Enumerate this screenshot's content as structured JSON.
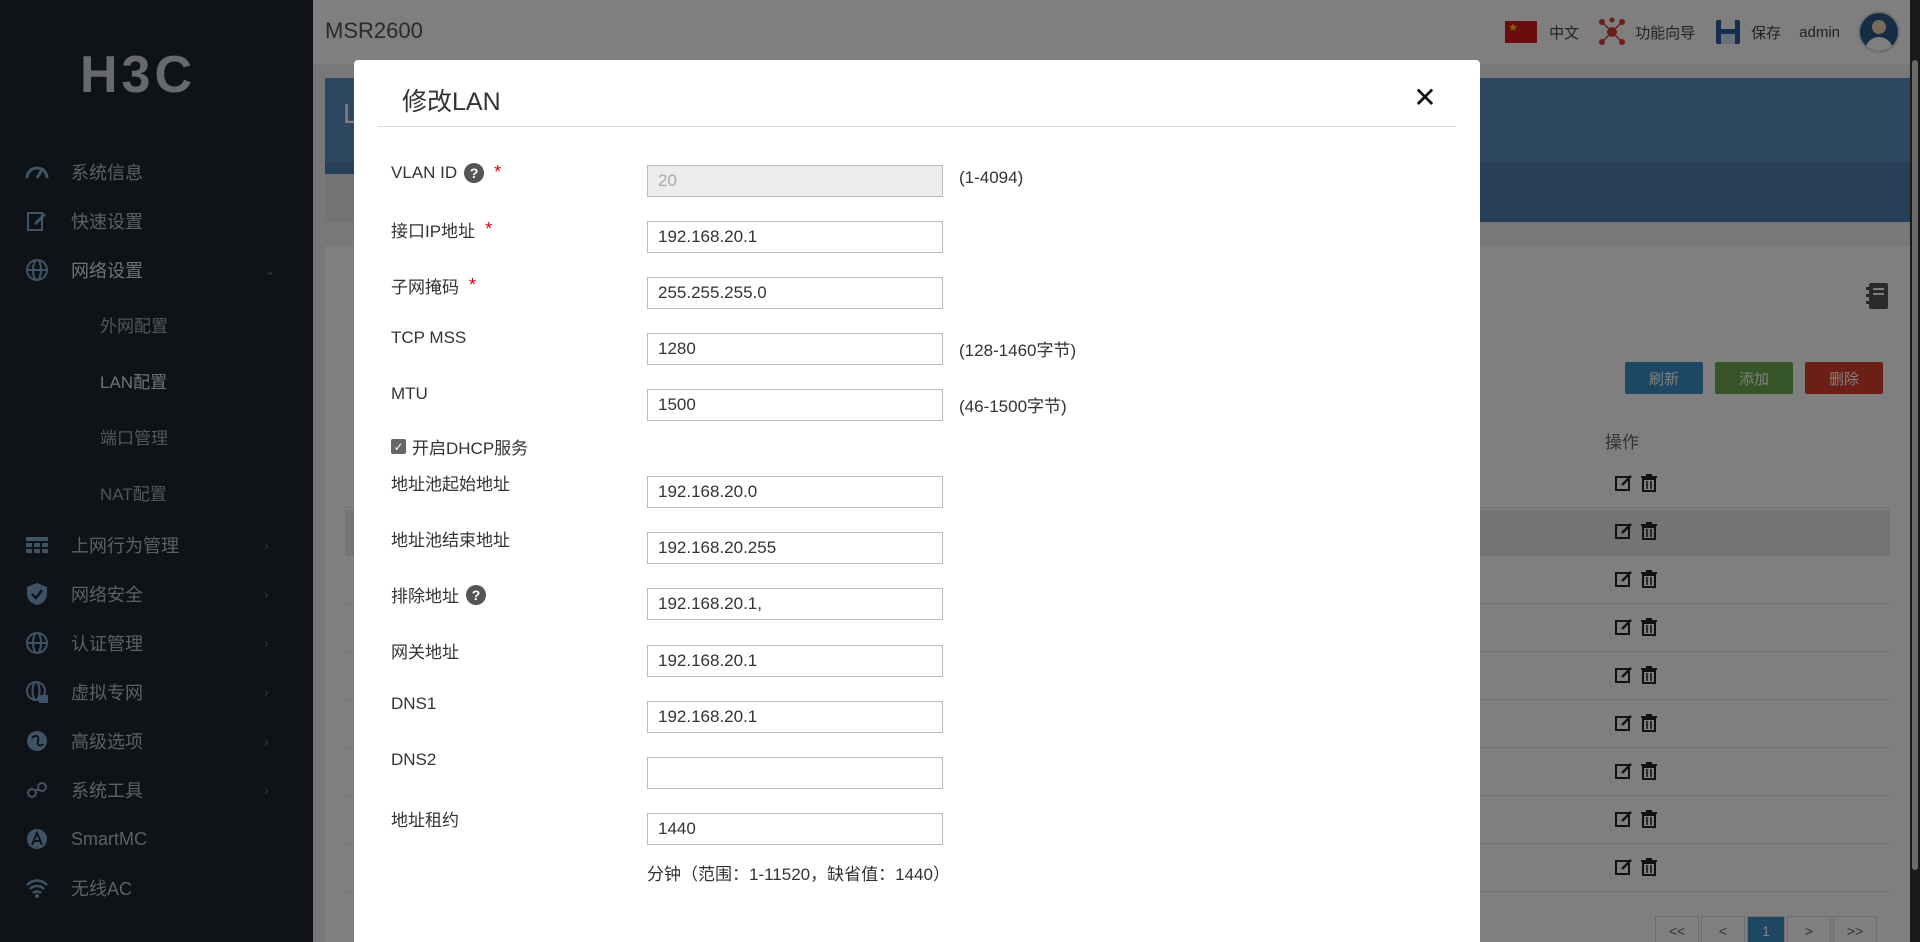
{
  "sidebar": {
    "logo": "H3C",
    "items": [
      {
        "label": "系统信息",
        "icon": "speedometer-icon"
      },
      {
        "label": "快速设置",
        "icon": "edit-icon"
      },
      {
        "label": "网络设置",
        "icon": "globe-icon",
        "expanded": true
      },
      {
        "label": "上网行为管理",
        "icon": "table-icon"
      },
      {
        "label": "网络安全",
        "icon": "shield-icon"
      },
      {
        "label": "认证管理",
        "icon": "globe-icon"
      },
      {
        "label": "虚拟专网",
        "icon": "globe-lock-icon"
      },
      {
        "label": "高级选项",
        "icon": "circle-icon"
      },
      {
        "label": "系统工具",
        "icon": "link-icon"
      },
      {
        "label": "SmartMC",
        "icon": "a-circle-icon"
      },
      {
        "label": "无线AC",
        "icon": "wifi-icon"
      }
    ],
    "subitems": [
      "外网配置",
      "LAN配置",
      "端口管理",
      "NAT配置"
    ]
  },
  "topbar": {
    "product": "MSR2600",
    "language": "中文",
    "wizard": "功能向导",
    "save": "保存",
    "user": "admin"
  },
  "background": {
    "header_initial": "L",
    "buttons": {
      "refresh": "刷新",
      "add": "添加",
      "delete": "删除"
    },
    "op_column": "操作",
    "pager": {
      "first": "<<",
      "prev": "<",
      "current": "1",
      "next": ">",
      "last": ">>"
    }
  },
  "modal": {
    "title": "修改LAN",
    "fields": {
      "vlan_id": {
        "label": "VLAN ID",
        "value": "20",
        "hint": "(1-4094)"
      },
      "ip": {
        "label": "接口IP地址",
        "value": "192.168.20.1"
      },
      "mask": {
        "label": "子网掩码",
        "value": "255.255.255.0"
      },
      "tcp_mss": {
        "label": "TCP MSS",
        "value": "1280",
        "hint": "(128-1460字节)"
      },
      "mtu": {
        "label": "MTU",
        "value": "1500",
        "hint": "(46-1500字节)"
      },
      "dhcp": {
        "label": "开启DHCP服务",
        "checked": true
      },
      "pool_start": {
        "label": "地址池起始地址",
        "value": "192.168.20.0"
      },
      "pool_end": {
        "label": "地址池结束地址",
        "value": "192.168.20.255"
      },
      "exclude": {
        "label": "排除地址",
        "value": "192.168.20.1,"
      },
      "gateway": {
        "label": "网关地址",
        "value": "192.168.20.1"
      },
      "dns1": {
        "label": "DNS1",
        "value": "192.168.20.1"
      },
      "dns2": {
        "label": "DNS2",
        "value": ""
      },
      "lease": {
        "label": "地址租约",
        "value": "1440",
        "note": "分钟（范围：1-11520，缺省值：1440）"
      }
    }
  }
}
